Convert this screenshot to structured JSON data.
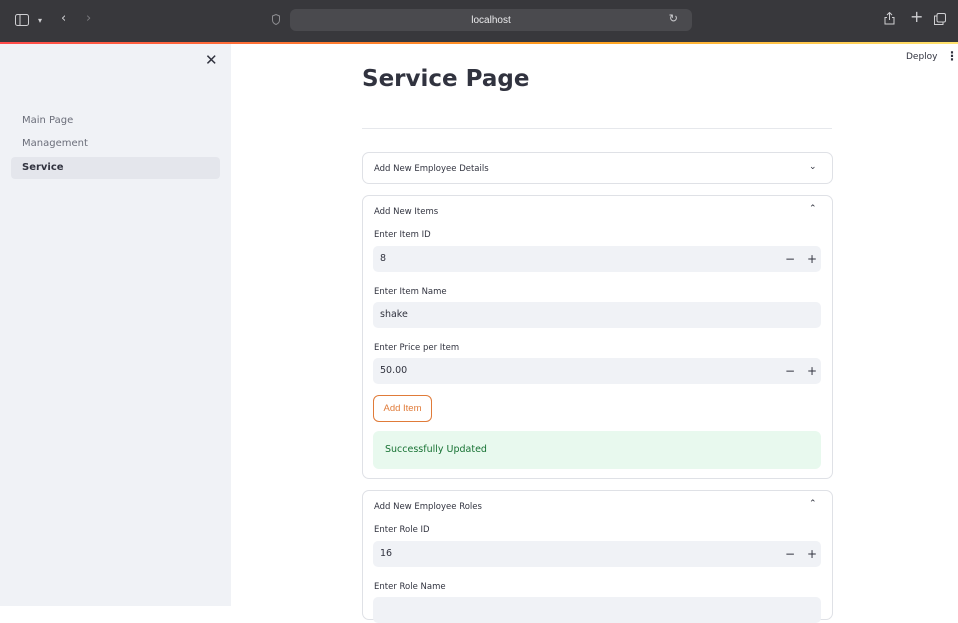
{
  "browser": {
    "url": "localhost",
    "icons": {
      "sidebar": "sidebar-icon",
      "back": "back-icon",
      "forward": "forward-icon",
      "shield": "shield-icon",
      "reload": "reload-icon",
      "share": "share-icon",
      "new_tab": "plus-icon",
      "tabs": "tabs-icon"
    }
  },
  "header": {
    "deploy_label": "Deploy"
  },
  "sidebar": {
    "items": [
      {
        "label": "Main Page",
        "active": false
      },
      {
        "label": "Management",
        "active": false
      },
      {
        "label": "Service",
        "active": true
      }
    ]
  },
  "main": {
    "title": "Service Page",
    "sections": {
      "employee_details": {
        "title": "Add New Employee Details"
      },
      "items": {
        "title": "Add New Items",
        "item_id_label": "Enter Item ID",
        "item_id_value": "8",
        "item_name_label": "Enter Item Name",
        "item_name_value": "shake",
        "price_label": "Enter Price per Item",
        "price_value": "50.00",
        "add_button": "Add Item",
        "success_message": "Successfully Updated"
      },
      "roles": {
        "title": "Add New Employee Roles",
        "role_id_label": "Enter Role ID",
        "role_id_value": "16",
        "role_name_label": "Enter Role Name"
      }
    }
  },
  "colors": {
    "accent": "#e07b39",
    "success_bg": "#e8f9ee",
    "success_text": "#177233",
    "sidebar_bg": "#f0f2f6"
  }
}
